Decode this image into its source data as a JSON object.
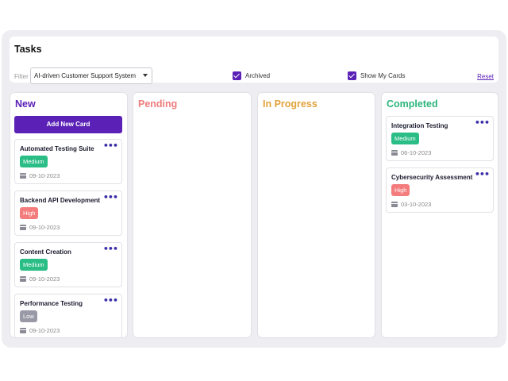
{
  "header": {
    "title": "Tasks",
    "filter_label": "Filter",
    "filter_value": "AI-driven Customer Support System",
    "archived_label": "Archived",
    "archived_checked": true,
    "show_my_cards_label": "Show My Cards",
    "show_my_cards_checked": true,
    "reset_label": "Reset"
  },
  "colors": {
    "accent": "#5b21b6",
    "new": "#5b21b6",
    "pending": "#f07c7c",
    "in_progress": "#e3a23b",
    "completed": "#2bb57b",
    "medium": "#2bbd86",
    "high": "#f47c7c",
    "low": "#9a9aa6"
  },
  "columns": [
    {
      "title": "New",
      "add_button_label": "Add New Card",
      "cards": [
        {
          "title": "Automated Testing Suite",
          "priority": "Medium",
          "date": "09-10-2023"
        },
        {
          "title": "Backend API Development",
          "priority": "High",
          "date": "09-10-2023"
        },
        {
          "title": "Content Creation",
          "priority": "Medium",
          "date": "09-10-2023"
        },
        {
          "title": "Performance Testing",
          "priority": "Low",
          "date": "09-10-2023"
        }
      ]
    },
    {
      "title": "Pending",
      "cards": []
    },
    {
      "title": "In Progress",
      "cards": []
    },
    {
      "title": "Completed",
      "cards": [
        {
          "title": "Integration Testing",
          "priority": "Medium",
          "date": "06-10-2023"
        },
        {
          "title": "Cybersecurity Assessment",
          "priority": "High",
          "date": "03-10-2023"
        }
      ]
    }
  ]
}
